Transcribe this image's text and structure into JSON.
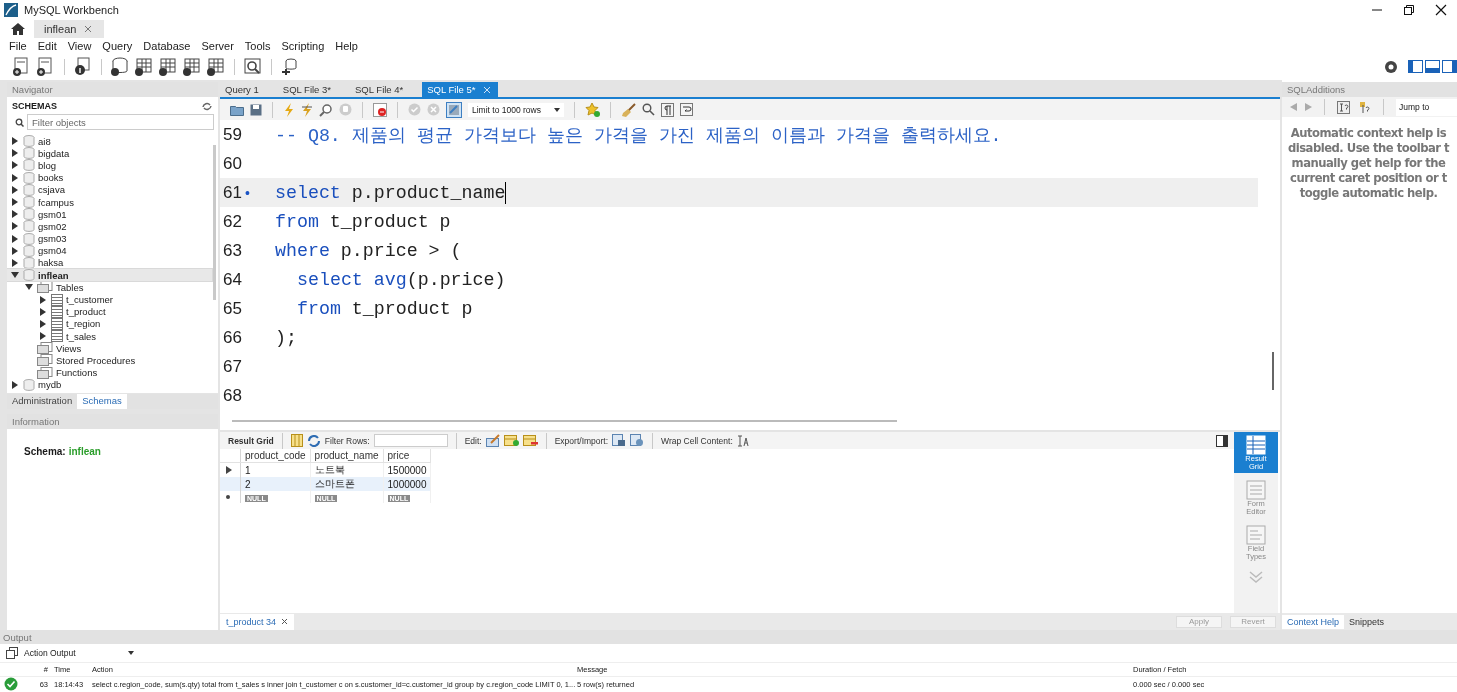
{
  "window": {
    "title": "MySQL Workbench"
  },
  "connection_tabs": [
    {
      "label": "inflean",
      "selected": true
    }
  ],
  "menu": [
    "File",
    "Edit",
    "View",
    "Query",
    "Database",
    "Server",
    "Tools",
    "Scripting",
    "Help"
  ],
  "navigator": {
    "title": "Navigator",
    "schemas_label": "SCHEMAS",
    "filter": {
      "placeholder": "Filter objects"
    },
    "tree": [
      {
        "label": "ai8",
        "kind": "schema",
        "expanded": false,
        "selected": false
      },
      {
        "label": "bigdata",
        "kind": "schema",
        "expanded": false,
        "selected": false
      },
      {
        "label": "blog",
        "kind": "schema",
        "expanded": false,
        "selected": false
      },
      {
        "label": "books",
        "kind": "schema",
        "expanded": false,
        "selected": false
      },
      {
        "label": "csjava",
        "kind": "schema",
        "expanded": false,
        "selected": false
      },
      {
        "label": "fcampus",
        "kind": "schema",
        "expanded": false,
        "selected": false
      },
      {
        "label": "gsm01",
        "kind": "schema",
        "expanded": false,
        "selected": false
      },
      {
        "label": "gsm02",
        "kind": "schema",
        "expanded": false,
        "selected": false
      },
      {
        "label": "gsm03",
        "kind": "schema",
        "expanded": false,
        "selected": false
      },
      {
        "label": "gsm04",
        "kind": "schema",
        "expanded": false,
        "selected": false
      },
      {
        "label": "haksa",
        "kind": "schema",
        "expanded": false,
        "selected": false
      },
      {
        "label": "inflean",
        "kind": "schema",
        "expanded": true,
        "selected": true,
        "children": [
          {
            "label": "Tables",
            "kind": "folder",
            "expanded": true,
            "selected": false,
            "children": [
              {
                "label": "t_customer",
                "kind": "table",
                "expanded": false,
                "selected": false
              },
              {
                "label": "t_product",
                "kind": "table",
                "expanded": false,
                "selected": false
              },
              {
                "label": "t_region",
                "kind": "table",
                "expanded": false,
                "selected": false
              },
              {
                "label": "t_sales",
                "kind": "table",
                "expanded": false,
                "selected": false
              }
            ]
          },
          {
            "label": "Views",
            "kind": "folder",
            "selected": false
          },
          {
            "label": "Stored Procedures",
            "kind": "folder",
            "selected": false
          },
          {
            "label": "Functions",
            "kind": "folder",
            "selected": false
          }
        ]
      },
      {
        "label": "mydb",
        "kind": "schema",
        "expanded": false,
        "selected": false
      }
    ],
    "tabs": [
      {
        "label": "Administration",
        "selected": false
      },
      {
        "label": "Schemas",
        "selected": true
      }
    ]
  },
  "information": {
    "title": "Information",
    "schema_label": "Schema:",
    "schema_name": "inflean"
  },
  "editor_tabs": [
    {
      "label": "Query 1",
      "selected": false
    },
    {
      "label": "SQL File 3*",
      "selected": false
    },
    {
      "label": "SQL File 4*",
      "selected": false
    },
    {
      "label": "SQL File 5*",
      "selected": true
    }
  ],
  "limit_select": {
    "value": "Limit to 1000 rows"
  },
  "editor": {
    "lines": [
      {
        "number": "59",
        "current": false,
        "segments": [
          {
            "kind": "comment",
            "text": "-- Q8. 제품의 평균 가격보다 높은 가격을 가진 제품의 이름과 가격을 출력하세요."
          }
        ]
      },
      {
        "number": "60",
        "current": false
      },
      {
        "number": "61",
        "marker": "•",
        "current": true,
        "segments": [
          {
            "kind": "keyword",
            "text": "select"
          },
          {
            "kind": "plain",
            "text": " p.product_name"
          }
        ]
      },
      {
        "number": "62",
        "current": false,
        "segments": [
          {
            "kind": "keyword",
            "text": "from"
          },
          {
            "kind": "plain",
            "text": " t_product p"
          }
        ]
      },
      {
        "number": "63",
        "current": false,
        "segments": [
          {
            "kind": "keyword",
            "text": "where"
          },
          {
            "kind": "plain",
            "text": " p.price > ("
          }
        ]
      },
      {
        "number": "64",
        "current": false,
        "indented": true,
        "segments": [
          {
            "kind": "keyword",
            "text": "select avg"
          },
          {
            "kind": "plain",
            "text": "(p.price)"
          }
        ]
      },
      {
        "number": "65",
        "current": false,
        "indented": true,
        "segments": [
          {
            "kind": "keyword",
            "text": "from"
          },
          {
            "kind": "plain",
            "text": " t_product p"
          }
        ]
      },
      {
        "number": "66",
        "current": false,
        "segments": [
          {
            "kind": "plain",
            "text": ");"
          }
        ]
      },
      {
        "number": "67",
        "current": false
      },
      {
        "number": "68",
        "current": false
      }
    ]
  },
  "result": {
    "toolbar": {
      "grid_label": "Result Grid",
      "filter_label": "Filter Rows:",
      "edit_label": "Edit:",
      "export_label": "Export/Import:",
      "wrap_label": "Wrap Cell Content:"
    },
    "columns": [
      "product_code",
      "product_name",
      "price"
    ],
    "rows": [
      {
        "cells": [
          "1",
          "노트북",
          "1500000"
        ],
        "current": true,
        "selected": false
      },
      {
        "cells": [
          "2",
          "스마트폰",
          "1000000"
        ],
        "current": false,
        "selected": true
      }
    ],
    "null_row": [
      "NULL",
      "NULL",
      "NULL"
    ],
    "side_tabs": [
      {
        "label": "Result Grid",
        "selected": true
      },
      {
        "label": "Form Editor",
        "selected": false
      },
      {
        "label": "Field Types",
        "selected": false
      }
    ],
    "tabs": [
      {
        "label": "t_product 34",
        "selected": true
      }
    ],
    "buttons": [
      {
        "label": "Apply",
        "disabled": true
      },
      {
        "label": "Revert",
        "disabled": true
      }
    ]
  },
  "sql_additions": {
    "title": "SQLAdditions",
    "jump": {
      "value": "Jump to"
    },
    "help_lines": [
      "Automatic context help is",
      "disabled. Use the toolbar t",
      "manually get help for the",
      "current caret position or t",
      "toggle automatic help."
    ],
    "tabs": [
      {
        "label": "Context Help",
        "selected": true
      },
      {
        "label": "Snippets",
        "selected": false
      }
    ]
  },
  "output": {
    "title": "Output",
    "selector": {
      "value": "Action Output"
    },
    "columns": [
      "#",
      "Time",
      "Action",
      "Message",
      "Duration / Fetch"
    ],
    "rows": [
      {
        "success": true,
        "cells": [
          "63",
          "18:14:43",
          "select c.region_code, sum(s.qty) total from t_sales s inner join t_customer c on s.customer_id=c.customer_id group by c.region_code LIMIT 0, 1...",
          "5 row(s) returned",
          "0.000 sec / 0.000 sec"
        ]
      }
    ]
  }
}
